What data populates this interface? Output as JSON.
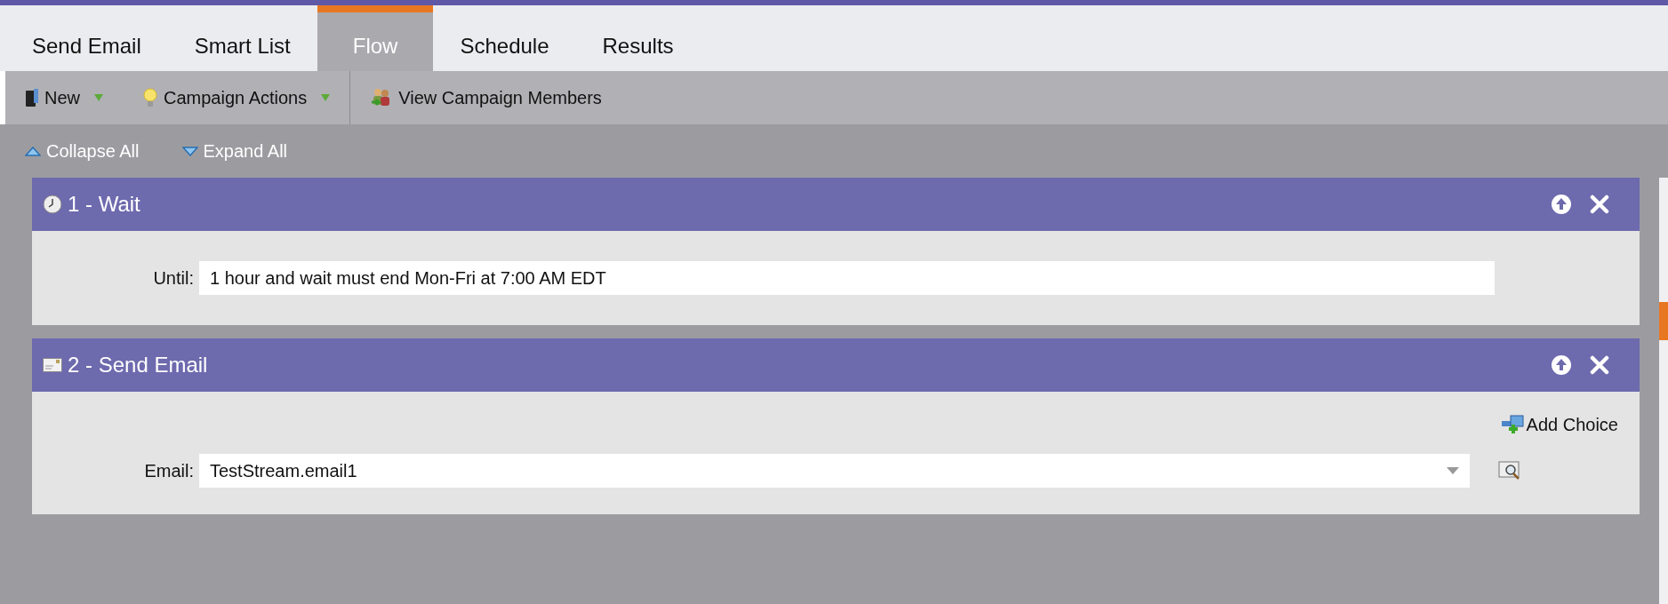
{
  "tabs": [
    {
      "label": "Send Email",
      "selected": false
    },
    {
      "label": "Smart List",
      "selected": false
    },
    {
      "label": "Flow",
      "selected": true
    },
    {
      "label": "Schedule",
      "selected": false
    },
    {
      "label": "Results",
      "selected": false
    }
  ],
  "toolbar": [
    {
      "label": "New",
      "kind": "new",
      "dropdown": true
    },
    {
      "label": "Campaign Actions",
      "kind": "actions",
      "dropdown": true
    },
    {
      "label": "View Campaign Members",
      "kind": "members",
      "dropdown": false
    }
  ],
  "outline_controls": [
    {
      "label": "Collapse All",
      "kind": "collapse"
    },
    {
      "label": "Expand All",
      "kind": "expand"
    }
  ],
  "steps": [
    {
      "title": "1 - Wait",
      "kind": "wait",
      "field": {
        "label": "Until:",
        "value": "1 hour and wait must end Mon-Fri at 7:00 AM EDT",
        "kind": "text"
      }
    },
    {
      "title": "2 - Send Email",
      "kind": "email",
      "add_choice": "Add Choice",
      "field": {
        "label": "Email:",
        "value": "TestStream.email1",
        "kind": "select"
      }
    }
  ]
}
